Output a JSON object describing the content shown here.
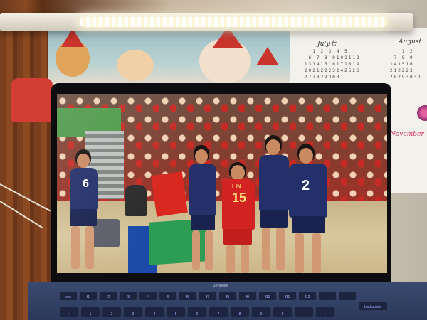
{
  "calendar": {
    "months": [
      "July七",
      "August",
      "November"
    ],
    "grid_left": "  1 2 3 4 5\n 6 7 8 9101112\n13141516171819\n20212223242526\n2728293031",
    "grid_right": "   1 2\n 7 8 9\n141516\n212223\n28293031"
  },
  "laptop": {
    "brand": "ZenBook",
    "keys": [
      "esc",
      "f1",
      "f2",
      "f3",
      "f4",
      "f5",
      "f6",
      "f7",
      "f8",
      "f9",
      "f10",
      "f11",
      "f12",
      "",
      "",
      "backspace"
    ],
    "number_keys": [
      "~",
      "1",
      "2",
      "3",
      "4",
      "5",
      "6",
      "7",
      "8",
      "9",
      "0",
      "-",
      "+"
    ]
  },
  "video": {
    "players": [
      {
        "number": "6",
        "name": ""
      },
      {
        "number": "15",
        "name": "LIN"
      },
      {
        "number": "2",
        "name": ""
      }
    ]
  },
  "colors": {
    "team_blue": "#23306a",
    "team_red": "#d32222",
    "keyboard_accent": "#9fb2ff"
  }
}
